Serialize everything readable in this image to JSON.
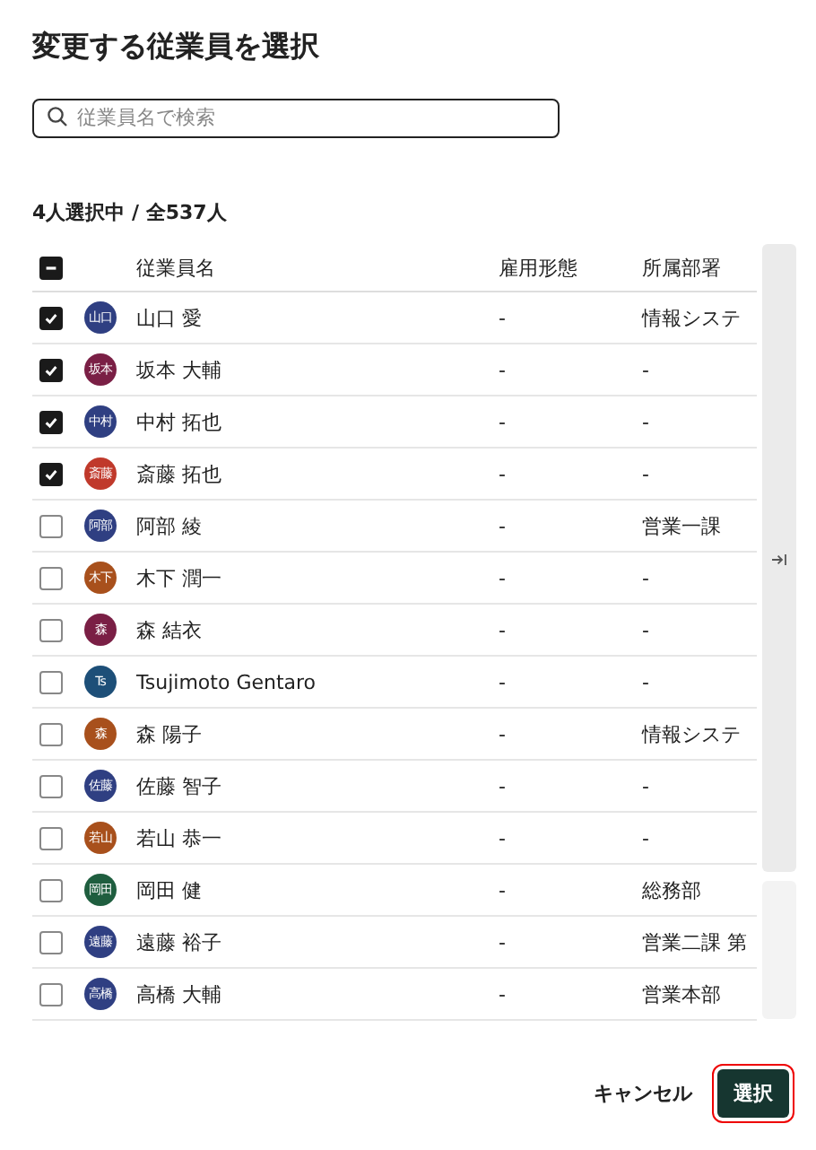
{
  "dialog": {
    "title": "変更する従業員を選択"
  },
  "search": {
    "placeholder": "従業員名で検索"
  },
  "selection_count": "4人選択中 / 全537人",
  "table": {
    "header_checkbox": {
      "indeterminate": true
    },
    "columns": [
      "従業員名",
      "雇用形態",
      "所属部署"
    ],
    "rows": [
      {
        "checked": true,
        "avatar": "山口",
        "color": "#2f3f82",
        "name": "山口 愛",
        "employment": "-",
        "department": "情報システ"
      },
      {
        "checked": true,
        "avatar": "坂本",
        "color": "#7a1f45",
        "name": "坂本 大輔",
        "employment": "-",
        "department": "-"
      },
      {
        "checked": true,
        "avatar": "中村",
        "color": "#2f3f82",
        "name": "中村 拓也",
        "employment": "-",
        "department": "-"
      },
      {
        "checked": true,
        "avatar": "斎藤",
        "color": "#c0392b",
        "name": "斎藤 拓也",
        "employment": "-",
        "department": "-"
      },
      {
        "checked": false,
        "avatar": "阿部",
        "color": "#2f3f82",
        "name": "阿部 綾",
        "employment": "-",
        "department": "営業一課"
      },
      {
        "checked": false,
        "avatar": "木下",
        "color": "#a8501c",
        "name": "木下 潤一",
        "employment": "-",
        "department": "-"
      },
      {
        "checked": false,
        "avatar": "森",
        "color": "#7a1f45",
        "name": "森 結衣",
        "employment": "-",
        "department": "-"
      },
      {
        "checked": false,
        "avatar": "Ts",
        "color": "#1d4f78",
        "name": "Tsujimoto Gentaro",
        "employment": "-",
        "department": "-"
      },
      {
        "checked": false,
        "avatar": "森",
        "color": "#a8501c",
        "name": "森 陽子",
        "employment": "-",
        "department": "情報システ"
      },
      {
        "checked": false,
        "avatar": "佐藤",
        "color": "#2f3f82",
        "name": "佐藤 智子",
        "employment": "-",
        "department": "-"
      },
      {
        "checked": false,
        "avatar": "若山",
        "color": "#a8501c",
        "name": "若山 恭一",
        "employment": "-",
        "department": "-"
      },
      {
        "checked": false,
        "avatar": "岡田",
        "color": "#1f5e3f",
        "name": "岡田 健",
        "employment": "-",
        "department": "総務部"
      },
      {
        "checked": false,
        "avatar": "遠藤",
        "color": "#2f3f82",
        "name": "遠藤 裕子",
        "employment": "-",
        "department": "営業二課 第"
      },
      {
        "checked": false,
        "avatar": "高橋",
        "color": "#2f3f82",
        "name": "高橋 大輔",
        "employment": "-",
        "department": "営業本部"
      }
    ]
  },
  "footer": {
    "cancel": "キャンセル",
    "confirm": "選択"
  }
}
